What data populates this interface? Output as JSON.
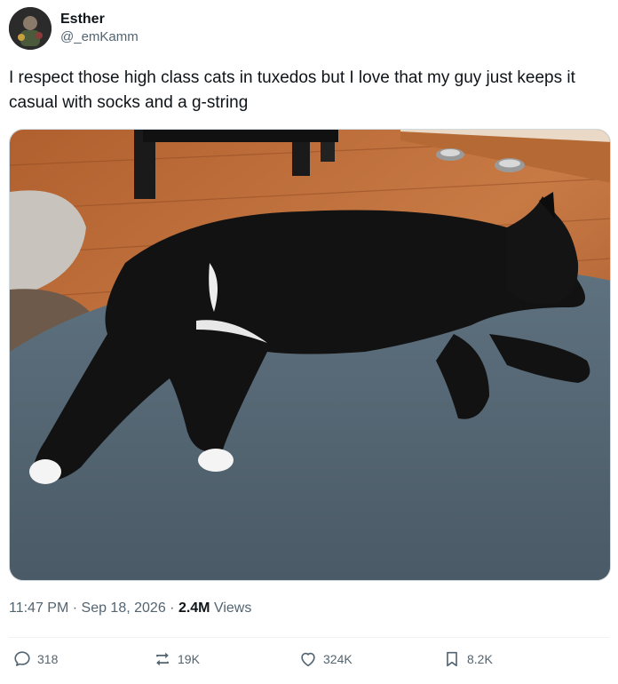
{
  "author": {
    "display_name": "Esther",
    "handle": "@_emKamm",
    "avatar_icon": "profile-avatar"
  },
  "tweet": {
    "text": "I respect those high class cats in tuxedos but I love that my guy just keeps it casual with socks and a g-string"
  },
  "meta": {
    "time": "11:47 PM",
    "separator": " · ",
    "date": "Sep 18, 2026",
    "views_count": "2.4M",
    "views_label": "Views"
  },
  "actions": {
    "reply_count": "318",
    "repost_count": "19K",
    "like_count": "324K",
    "bookmark_count": "8.2K"
  },
  "colors": {
    "text_primary": "#0f1419",
    "text_secondary": "#536471",
    "divider": "#eff3f4"
  }
}
